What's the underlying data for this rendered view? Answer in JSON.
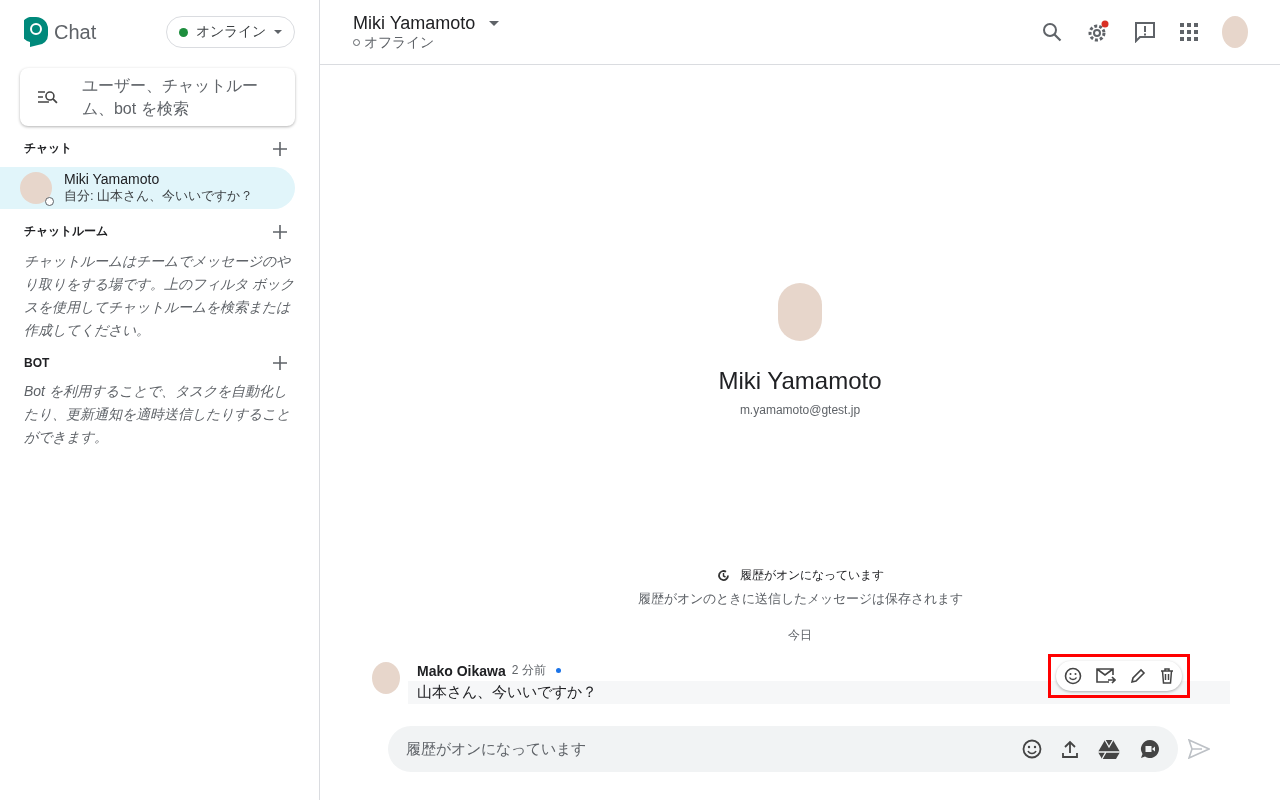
{
  "app": {
    "name": "Chat"
  },
  "status": {
    "label": "オンライン",
    "color": "#1e8e3e"
  },
  "search": {
    "placeholder": "ユーザー、チャットルーム、bot を検索"
  },
  "sections": [
    {
      "title": "チャット",
      "kind": "list",
      "items": [
        {
          "name": "Miki Yamamoto",
          "preview": "自分: 山本さん、今いいですか？",
          "selected": true
        }
      ]
    },
    {
      "title": "チャットルーム",
      "kind": "note",
      "text": "チャットルームはチームでメッセージのやり取りをする場です。上のフィルタ ボックスを使用してチャットルームを検索または作成してください。"
    },
    {
      "title": "BOT",
      "kind": "note",
      "text": "Bot を利用することで、タスクを自動化したり、更新通知を適時送信したりすることができます。"
    }
  ],
  "header": {
    "name": "Miki Yamamoto",
    "presence": "オフライン"
  },
  "profile": {
    "name": "Miki Yamamoto",
    "email": "m.yamamoto@gtest.jp"
  },
  "history": {
    "title": "履歴がオンになっています",
    "note": "履歴がオンのときに送信したメッセージは保存されます"
  },
  "date_divider": "今日",
  "messages": [
    {
      "author": "Mako Oikawa",
      "time": "2 分前",
      "text": "山本さん、今いいですか？",
      "highlighted": true
    }
  ],
  "composer": {
    "placeholder": "履歴がオンになっています"
  }
}
